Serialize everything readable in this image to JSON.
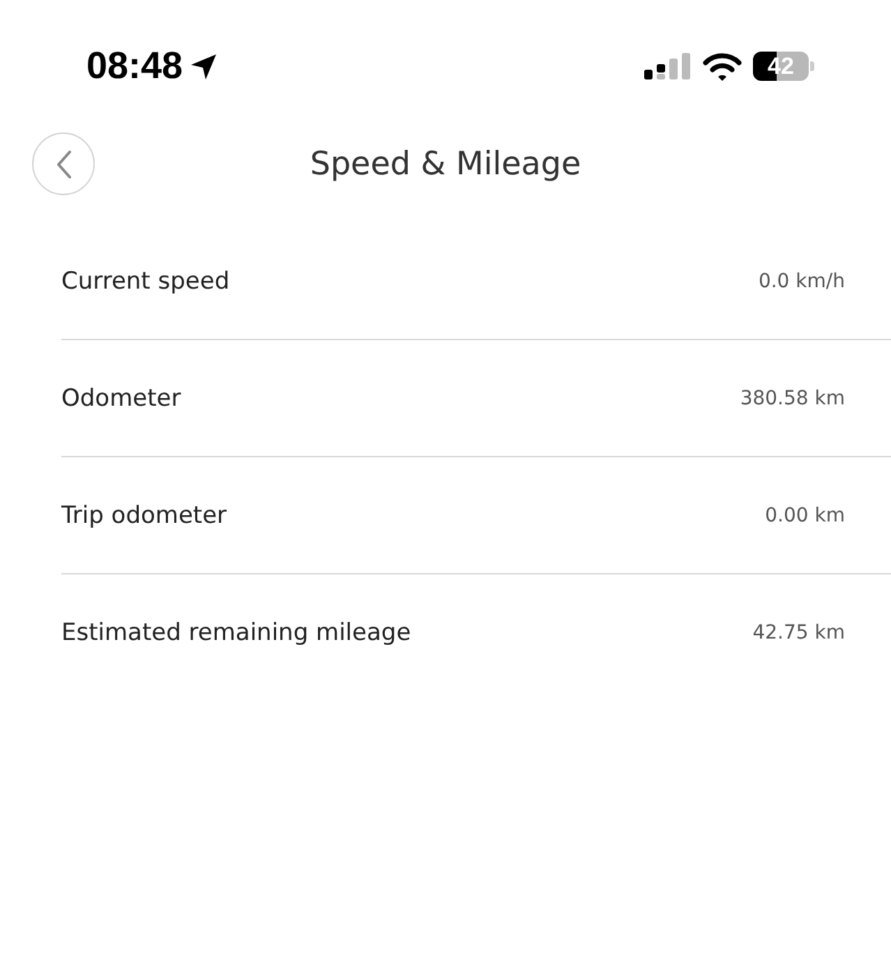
{
  "status_bar": {
    "time": "08:48",
    "battery": "42"
  },
  "header": {
    "title": "Speed & Mileage"
  },
  "rows": [
    {
      "label": "Current speed",
      "value": "0.0 km/h"
    },
    {
      "label": "Odometer",
      "value": "380.58 km"
    },
    {
      "label": "Trip odometer",
      "value": "0.00 km"
    },
    {
      "label": "Estimated remaining mileage",
      "value": "42.75 km"
    }
  ]
}
